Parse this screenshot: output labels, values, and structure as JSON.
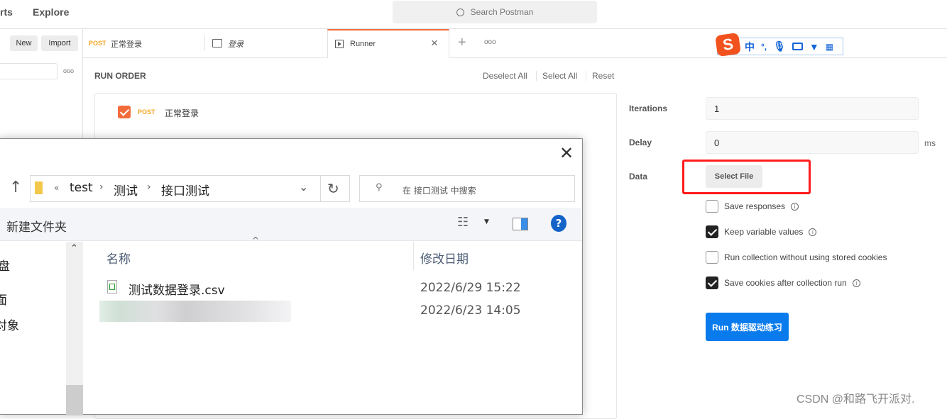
{
  "topbar": {
    "nav_partial": "rts",
    "explore": "Explore",
    "search_placeholder": "Search Postman"
  },
  "sidebar": {
    "new_label": "New",
    "import_label": "Import",
    "more": "ooo"
  },
  "tabs": [
    {
      "method": "POST",
      "label": "正常登录"
    },
    {
      "label": "登录",
      "icon": "folder-icon"
    },
    {
      "label": "Runner",
      "icon": "runner-icon",
      "active": true
    }
  ],
  "tab_actions": {
    "add": "+",
    "more": "ooo"
  },
  "ime": {
    "lang": "中",
    "punct": "°,"
  },
  "run_order": {
    "title": "RUN ORDER",
    "deselect_all": "Deselect All",
    "select_all": "Select All",
    "reset": "Reset",
    "items": [
      {
        "checked": true,
        "method": "POST",
        "name": "正常登录"
      }
    ]
  },
  "settings": {
    "iterations_label": "Iterations",
    "iterations_value": "1",
    "delay_label": "Delay",
    "delay_value": "0",
    "delay_unit": "ms",
    "data_label": "Data",
    "select_file": "Select File",
    "options": [
      {
        "label": "Save responses",
        "checked": false,
        "info": true
      },
      {
        "label": "Keep variable values",
        "checked": true,
        "info": true
      },
      {
        "label": "Run collection without using stored cookies",
        "checked": false,
        "info": false
      },
      {
        "label": "Save cookies after collection run",
        "checked": true,
        "info": true
      }
    ],
    "run_button": "Run 数据驱动练习"
  },
  "dialog": {
    "breadcrumb": [
      "«",
      "test",
      "测试",
      "接口测试"
    ],
    "search_placeholder": "在 接口测试 中搜索",
    "new_folder": "新建文件夹",
    "nav_items": [
      "盘",
      "面",
      "对象"
    ],
    "columns": {
      "name": "名称",
      "modified": "修改日期"
    },
    "files": [
      {
        "name": "测试数据登录.csv",
        "modified": "2022/6/29 15:22"
      },
      {
        "name": "",
        "modified": "2022/6/23 14:05"
      }
    ]
  },
  "watermark": "CSDN @和路飞开派对.",
  "colors": {
    "accent": "#f26b3a",
    "post": "#f5a623",
    "run": "#097bed",
    "highlight": "#ff1a1a"
  }
}
